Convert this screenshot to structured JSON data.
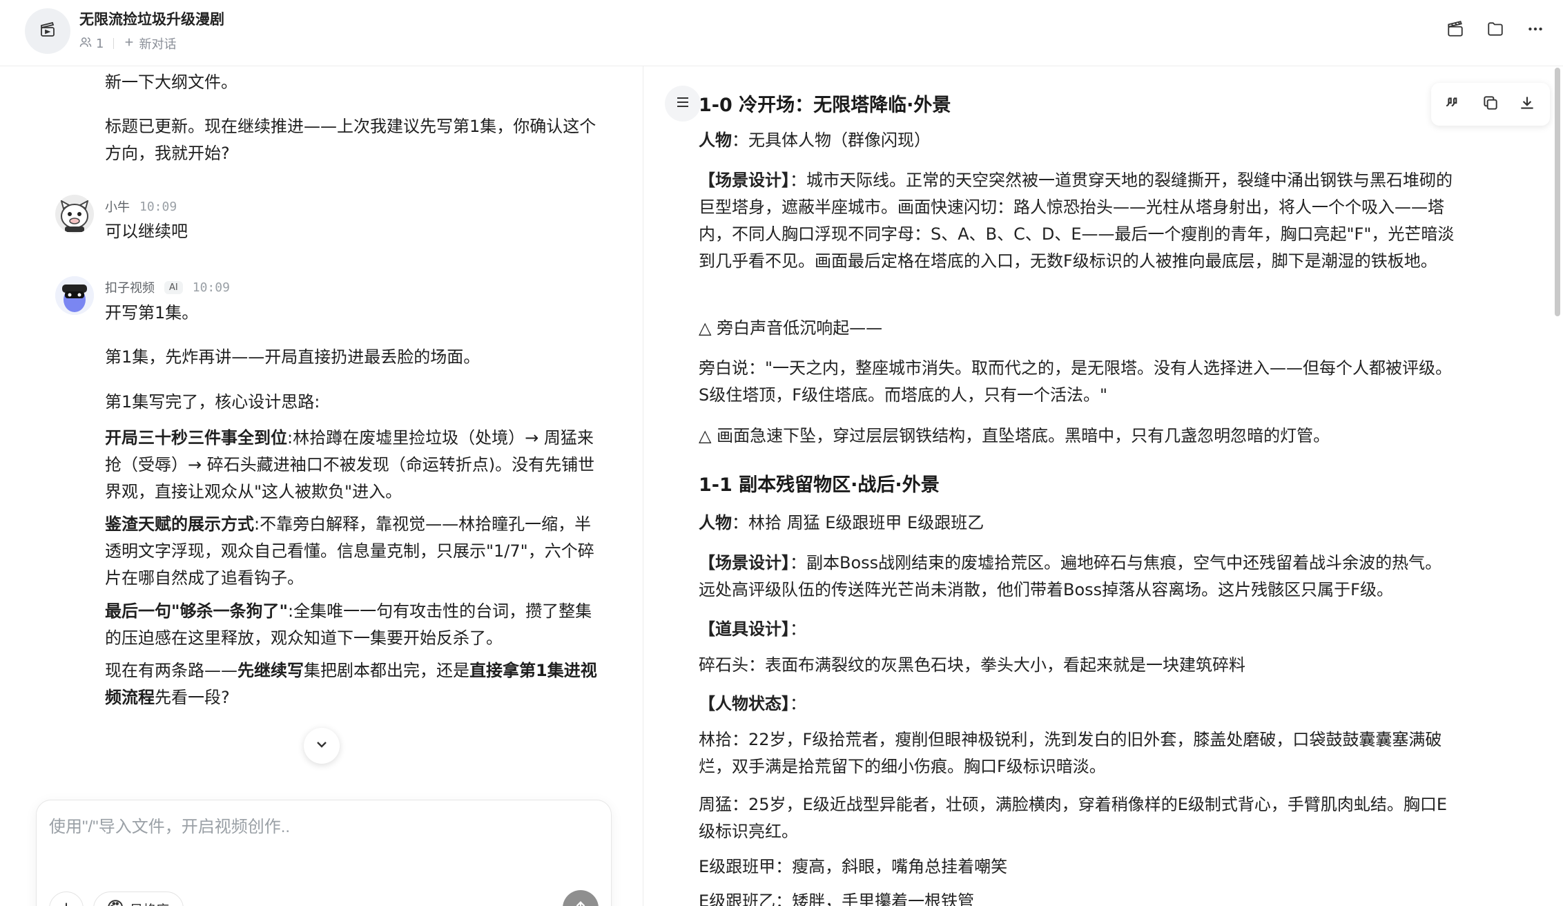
{
  "header": {
    "title": "无限流捡垃圾升级漫剧",
    "member_count": "1",
    "new_chat_label": "新对话",
    "actions": [
      "clapperboard-icon",
      "folder-icon",
      "more-icon"
    ]
  },
  "chat": {
    "messages": {
      "m0_p1": "新一下大纲文件。",
      "m0_p2": "标题已更新。现在继续推进——上次我建议先写第1集，你确认这个方向，我就开始?",
      "user_name": "小牛",
      "user_time": "10:09",
      "user_text": "可以继续吧",
      "ai_name": "扣子视频",
      "ai_badge": "AI",
      "ai_time": "10:09",
      "ai_p1": "开写第1集。",
      "ai_p2": "第1集，先炸再讲——开局直接扔进最丢脸的场面。",
      "ai_p3": "第1集写完了，核心设计思路:",
      "ai_b1_head": "开局三十秒三件事全到位",
      "ai_b1_text": ":林拾蹲在废墟里捡垃圾（处境）→ 周猛来抢（受辱）→ 碎石头藏进袖口不被发现（命运转折点)。没有先铺世界观，直接让观众从\"这人被欺负\"进入。",
      "ai_b2_head": "鉴渣天赋的展示方式",
      "ai_b2_text": ":不靠旁白解释，靠视觉——林拾瞳孔一缩，半透明文字浮现，观众自己看懂。信息量克制，只展示\"1/7\"，六个碎片在哪自然成了追看钩子。",
      "ai_b3_head": "最后一句\"够杀一条狗了\"",
      "ai_b3_text": ":全集唯一一句有攻击性的台词，攒了整集的压迫感在这里释放，观众知道下一集要开始反杀了。",
      "ai_p4_a": "现在有两条路——",
      "ai_p4_b": "先继续写",
      "ai_p4_c": "集把剧本都出完，还是",
      "ai_p4_d": "直接拿第1集进视频流程",
      "ai_p4_e": "先看一段",
      "ai_p4_f": "?"
    }
  },
  "composer": {
    "placeholder": "使用\"/\"导入文件，开启视频创作..",
    "style_lib_label": "风格库"
  },
  "document": {
    "s0_title": "1-0 冷开场：无限塔降临·外景",
    "s0_people_label": "人物",
    "s0_people": "：无具体人物（群像闪现）",
    "s0_scene_label": "【场景设计】",
    "s0_scene": "：城市天际线。正常的天空突然被一道贯穿天地的裂缝撕开，裂缝中涌出钢铁与黑石堆砌的巨型塔身，遮蔽半座城市。画面快速闪切：路人惊恐抬头——光柱从塔身射出，将人一个个吸入——塔内，不同人胸口浮现不同字母：S、A、B、C、D、E——最后一个瘦削的青年，胸口亮起\"F\"，光芒暗淡到几乎看不见。画面最后定格在塔底的入口，无数F级标识的人被推向最底层，脚下是潮湿的铁板地。",
    "s0_delta1": "△ 旁白声音低沉响起——",
    "s0_narration": "旁白说：\"一天之内，整座城市消失。取而代之的，是无限塔。没有人选择进入——但每个人都被评级。S级住塔顶，F级住塔底。而塔底的人，只有一个活法。\"",
    "s0_delta2": "△ 画面急速下坠，穿过层层钢铁结构，直坠塔底。黑暗中，只有几盏忽明忽暗的灯管。",
    "s1_title": "1-1 副本残留物区·战后·外景",
    "s1_people_label": "人物",
    "s1_people": "：林拾 周猛 E级跟班甲 E级跟班乙",
    "s1_scene_label": "【场景设计】",
    "s1_scene": "：副本Boss战刚结束的废墟拾荒区。遍地碎石与焦痕，空气中还残留着战斗余波的热气。远处高评级队伍的传送阵光芒尚未消散，他们带着Boss掉落从容离场。这片残骸区只属于F级。",
    "s1_props_label": "【道具设计】",
    "s1_props_colon": "：",
    "s1_prop1": "碎石头：表面布满裂纹的灰黑色石块，拳头大小，看起来就是一块建筑碎料",
    "s1_status_label": "【人物状态】",
    "s1_status_colon": "：",
    "s1_char1": "林拾：22岁，F级拾荒者，瘦削但眼神极锐利，洗到发白的旧外套，膝盖处磨破，口袋鼓鼓囊囊塞满破烂，双手满是拾荒留下的细小伤痕。胸口F级标识暗淡。",
    "s1_char2": "周猛：25岁，E级近战型异能者，壮硕，满脸横肉，穿着稍像样的E级制式背心，手臂肌肉虬结。胸口E级标识亮红。",
    "s1_char3": "E级跟班甲：瘦高，斜眼，嘴角总挂着嘲笑",
    "s1_char4": "E级跟班乙：矮胖，手里攥着一根铁管"
  }
}
